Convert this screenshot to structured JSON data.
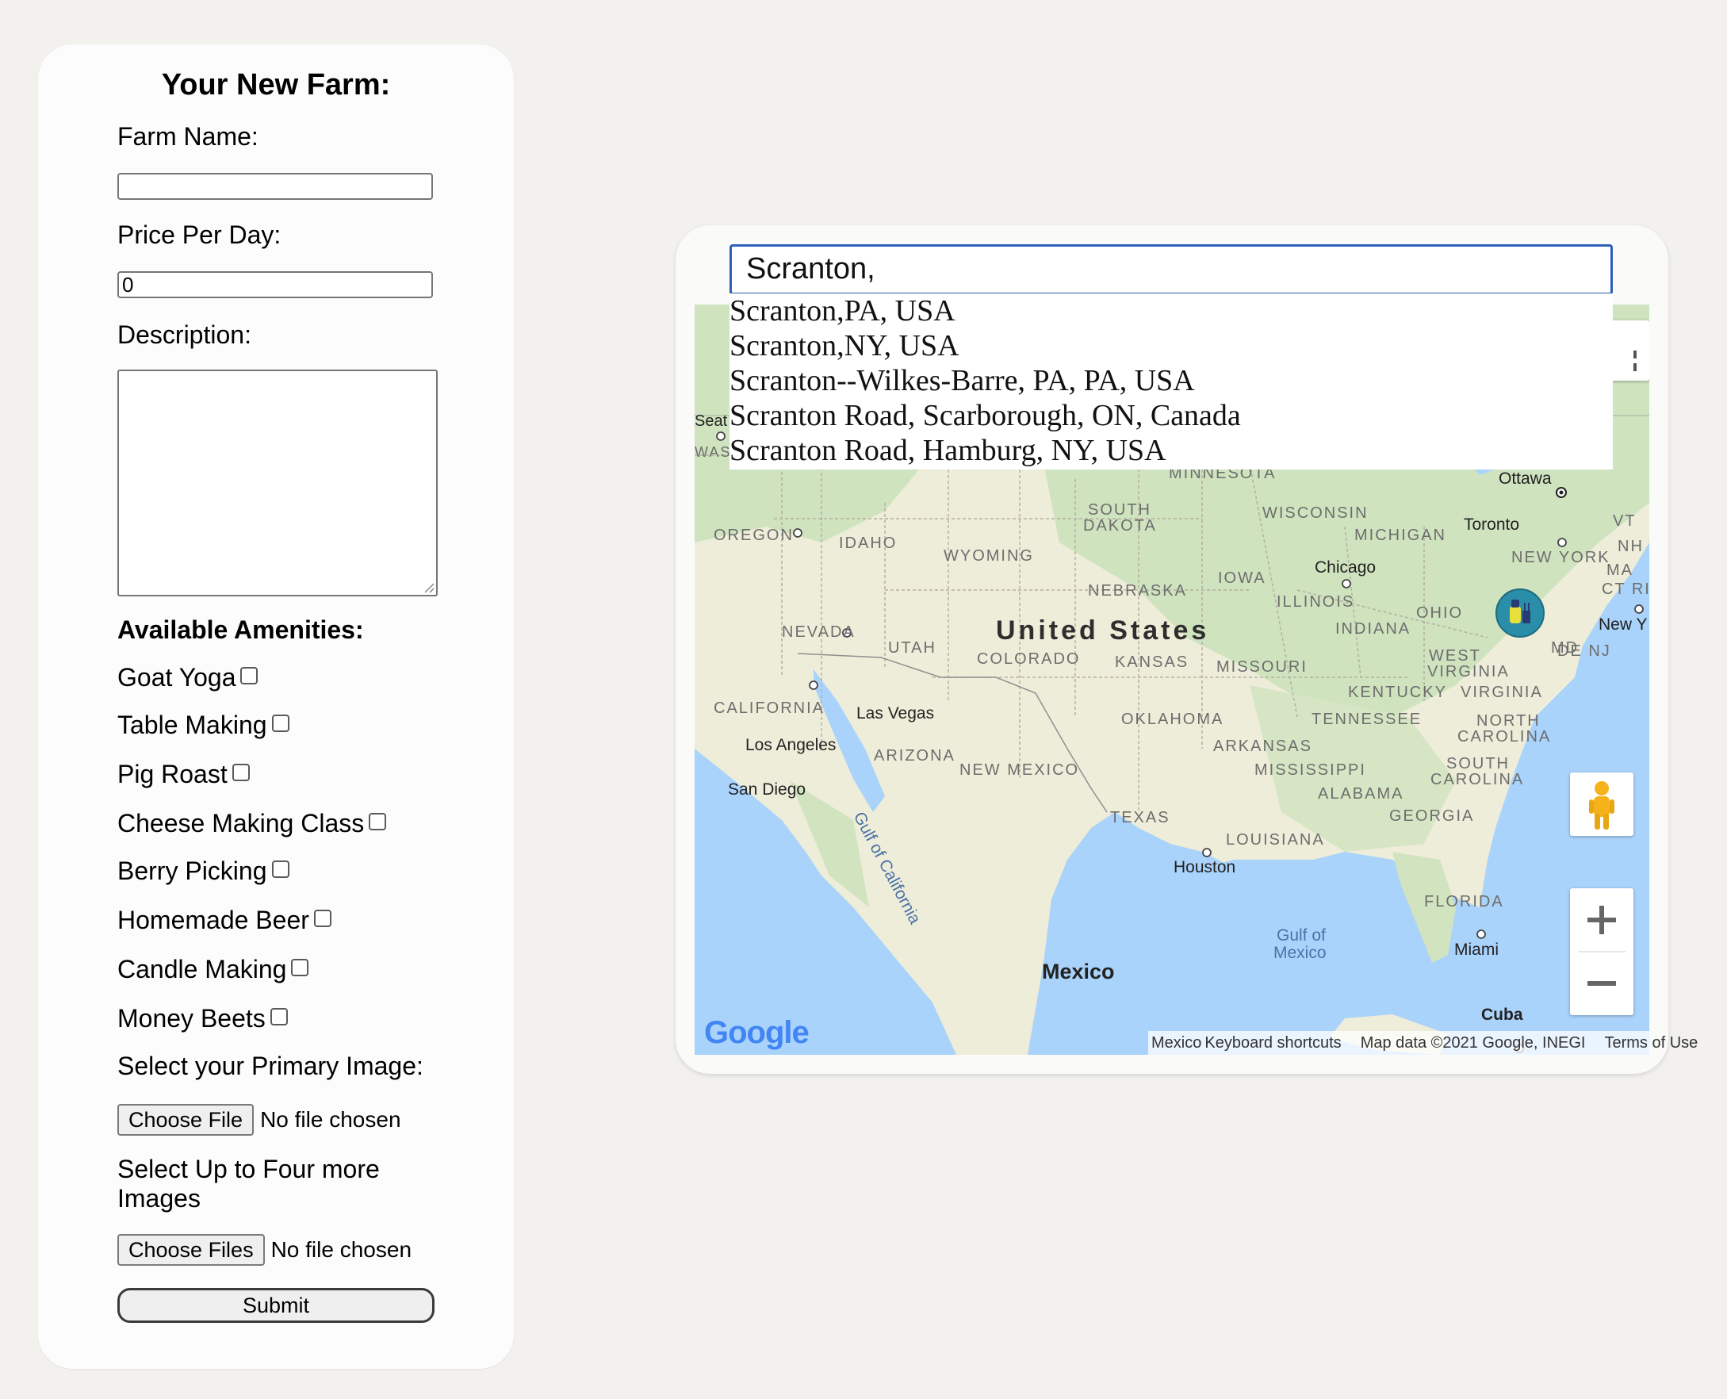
{
  "form": {
    "title": "Your New Farm:",
    "farm_name_label": "Farm Name:",
    "farm_name_value": "",
    "price_label": "Price Per Day:",
    "price_value": "0",
    "description_label": "Description:",
    "description_value": "",
    "amenities_heading": "Available Amenities:",
    "amenities": [
      {
        "label": "Goat Yoga",
        "checked": false
      },
      {
        "label": "Table Making",
        "checked": false
      },
      {
        "label": "Pig Roast",
        "checked": false
      },
      {
        "label": "Cheese Making Class",
        "checked": false
      },
      {
        "label": "Berry Picking",
        "checked": false
      },
      {
        "label": "Homemade Beer",
        "checked": false
      },
      {
        "label": "Candle Making",
        "checked": false
      },
      {
        "label": "Money Beets",
        "checked": false
      }
    ],
    "primary_image_label": "Select your Primary Image:",
    "primary_file_button": "Choose File",
    "primary_file_status": "No file chosen",
    "more_images_label_line1": "Select Up to Four more",
    "more_images_label_line2": "Images",
    "more_files_button": "Choose Files",
    "more_files_status": "No file chosen",
    "submit_label": "Submit"
  },
  "map": {
    "search_value": "Scranton,",
    "suggestions": [
      "Scranton,PA, USA",
      "Scranton,NY, USA",
      "Scranton--Wilkes-Barre, PA, PA, USA",
      "Scranton Road, Scarborough, ON, Canada",
      "Scranton Road, Hamburg, NY, USA"
    ],
    "country_label": "United States",
    "mexico_label": "Mexico",
    "states": {
      "minnesota": "MINNESOTA",
      "wisconsin": "WISCONSIN",
      "michigan": "MICHIGAN",
      "south_dakota_1": "SOUTH",
      "south_dakota_2": "DAKOTA",
      "oregon": "OREGON",
      "idaho": "IDAHO",
      "wyoming": "WYOMING",
      "nebraska": "NEBRASKA",
      "iowa": "IOWA",
      "illinois": "ILLINOIS",
      "ohio": "OHIO",
      "indiana": "INDIANA",
      "new_york": "NEW YORK",
      "nevada": "NEVADA",
      "utah": "UTAH",
      "colorado": "COLORADO",
      "kansas": "KANSAS",
      "missouri": "MISSOURI",
      "west_virginia_1": "WEST",
      "west_virginia_2": "VIRGINIA",
      "kentucky": "KENTUCKY",
      "virginia": "VIRGINIA",
      "california": "CALIFORNIA",
      "oklahoma": "OKLAHOMA",
      "tennessee": "TENNESSEE",
      "north_carolina_1": "NORTH",
      "north_carolina_2": "CAROLINA",
      "arizona": "ARIZONA",
      "arkansas": "ARKANSAS",
      "new_mexico": "NEW MEXICO",
      "mississippi": "MISSISSIPPI",
      "south_carolina_1": "SOUTH",
      "south_carolina_2": "CAROLINA",
      "alabama": "ALABAMA",
      "georgia": "GEORGIA",
      "texas": "TEXAS",
      "louisiana": "LOUISIANA",
      "florida": "FLORIDA",
      "vt": "VT",
      "nh": "NH",
      "ma": "MA",
      "ct_ri": "CT RI",
      "md": "MD",
      "de_nj": "DE NJ"
    },
    "cities": {
      "ottawa": "Ottawa",
      "toronto": "Toronto",
      "chicago": "Chicago",
      "new_york": "New Y",
      "las_vegas": "Las Vegas",
      "los_angeles": "Los Angeles",
      "san_diego": "San Diego",
      "houston": "Houston",
      "miami": "Miami",
      "cuba": "Cuba",
      "seattle": "Seat",
      "was": "WAS"
    },
    "water": {
      "gulf_california": "Gulf of California",
      "gulf_mexico_1": "Gulf of",
      "gulf_mexico_2": "Mexico"
    },
    "google_logo": "Google",
    "attribution": {
      "mexico_partial": "Mexico",
      "shortcuts": "Keyboard shortcuts",
      "map_data": "Map data ©2021 Google, INEGI",
      "terms": "Terms of Use"
    },
    "colors": {
      "land": "#eeedd9",
      "green": "#c9dfb5",
      "water": "#aad3fb",
      "search_border": "#2c5fb8"
    }
  }
}
